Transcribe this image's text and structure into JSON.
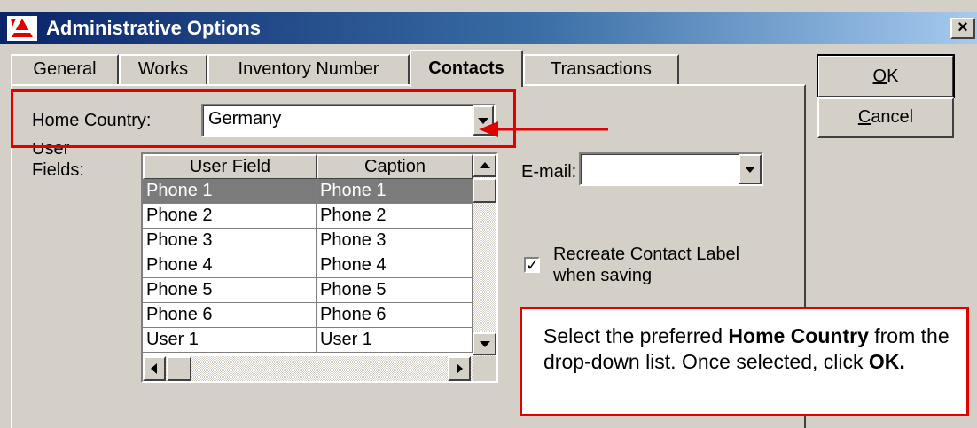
{
  "window": {
    "title": "Administrative Options",
    "close_symbol": "×"
  },
  "tabs": [
    {
      "label": "General",
      "active": false
    },
    {
      "label": "Works",
      "active": false
    },
    {
      "label": "Inventory Number",
      "active": false
    },
    {
      "label": "Contacts",
      "active": true
    },
    {
      "label": "Transactions",
      "active": false
    }
  ],
  "home_country": {
    "label": "Home Country:",
    "value": "Germany"
  },
  "user_fields": {
    "label_line1": "User",
    "label_line2": "Fields:",
    "columns": [
      "User Field",
      "Caption"
    ],
    "rows": [
      [
        "Phone 1",
        "Phone 1"
      ],
      [
        "Phone 2",
        "Phone 2"
      ],
      [
        "Phone 3",
        "Phone 3"
      ],
      [
        "Phone 4",
        "Phone 4"
      ],
      [
        "Phone 5",
        "Phone 5"
      ],
      [
        "Phone 6",
        "Phone 6"
      ],
      [
        "User 1",
        "User 1"
      ]
    ],
    "selected_row": 0
  },
  "email": {
    "label": "E-mail:",
    "value": ""
  },
  "recreate_label": {
    "line1": "Recreate Contact Label",
    "line2": "when saving",
    "checked": true,
    "check_symbol": "✓"
  },
  "buttons": {
    "ok": {
      "mnemonic": "O",
      "rest": "K"
    },
    "cancel": {
      "mnemonic": "C",
      "rest": "ancel"
    }
  },
  "callout": {
    "part1": "Select the preferred ",
    "bold1": "Home Country",
    "part2": " from the drop-down list. Once selected, click ",
    "bold2": "OK."
  },
  "colors": {
    "annotation": "#e00000",
    "titlebar": "#0a246a",
    "face": "#d4d0c8",
    "selection": "#7b7b7b"
  }
}
